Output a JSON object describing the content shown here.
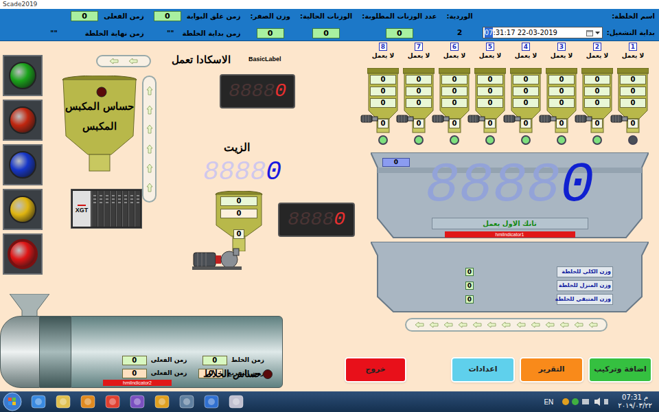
{
  "window": {
    "title": "Scade2019"
  },
  "header": {
    "recipe_label": "اسم الخلطة:",
    "start_label": "بداية التشغيل:",
    "start_time_selected": "07",
    "start_time_rest": ":31:17 22-03-2019",
    "shift_label": "الوردية:",
    "shift_value": "2",
    "required_label": "عدد الوزنات المطلوبة:",
    "required_value": "0",
    "current_label": "الوزنات الحالية:",
    "current_value": "0",
    "zero_label": "وزن الصفر:",
    "zero_value": "0",
    "gate_label": "زمن غلق البوابة",
    "gate_value": "0",
    "actual_label": "زمن الفعلى",
    "actual_value": "0",
    "mix_start_label": "زمن بداية الخلطة",
    "mix_start_value": "\"\"",
    "mix_end_label": "زمن نهاية الخلطة",
    "mix_end_value": "\"\""
  },
  "lights": [
    {
      "kind": "lamp",
      "color": "#1aa31a"
    },
    {
      "kind": "lamp",
      "color": "#c0260f"
    },
    {
      "kind": "lamp",
      "color": "#1636c8"
    },
    {
      "kind": "lamp",
      "color": "#e0b510"
    },
    {
      "kind": "button",
      "color": "#e01515"
    }
  ],
  "press": {
    "sensor_label": "حساس المكبس",
    "name": "المكبس"
  },
  "plc": {
    "label": "XGT"
  },
  "scada_status": "الاسكادا تعمل",
  "basic_label": "BasicLabel",
  "display_top": {
    "ghost": "8888",
    "value": "0"
  },
  "oil": {
    "label": "الزيت",
    "ghost": "8888",
    "value": "0",
    "tank_values": [
      "0",
      "0",
      "0"
    ],
    "display_ghost": "8888",
    "display_value": "0"
  },
  "hoppers": [
    {
      "number": "1",
      "status": "لا يعمل",
      "values": [
        "0",
        "0",
        "0",
        "0"
      ],
      "running": false
    },
    {
      "number": "2",
      "status": "لا يعمل",
      "values": [
        "0",
        "0",
        "0",
        "0"
      ],
      "running": true
    },
    {
      "number": "3",
      "status": "لا يعمل",
      "values": [
        "0",
        "0",
        "0",
        "0"
      ],
      "running": true
    },
    {
      "number": "4",
      "status": "لا يعمل",
      "values": [
        "0",
        "0",
        "0",
        "0"
      ],
      "running": true
    },
    {
      "number": "5",
      "status": "لا يعمل",
      "values": [
        "0",
        "0",
        "0",
        "0"
      ],
      "running": true
    },
    {
      "number": "6",
      "status": "لا يعمل",
      "values": [
        "0",
        "0",
        "0",
        "0"
      ],
      "running": true
    },
    {
      "number": "7",
      "status": "لا يعمل",
      "values": [
        "0",
        "0",
        "0",
        "0"
      ],
      "running": true
    },
    {
      "number": "8",
      "status": "لا يعمل",
      "values": [
        "0",
        "0",
        "0",
        "0"
      ],
      "running": true
    }
  ],
  "scale": {
    "tag": "0",
    "ghost": "8888",
    "value": "0",
    "status": "تانك الاول يعمل",
    "indicator": "hmiIndicator1"
  },
  "totals": [
    {
      "label": "وزن الكلي للخلطة",
      "value": "0"
    },
    {
      "label": "وزن المنزل للخلطة",
      "value": "0"
    },
    {
      "label": "وزن المتبقي للخلطة",
      "value": "0"
    }
  ],
  "mixer": {
    "fields": [
      {
        "label": "زمن الخلط",
        "value": "0",
        "color": "#d8f7c0"
      },
      {
        "label": "زمن الفعلى",
        "value": "0",
        "color": "#d8f7c0"
      },
      {
        "label": "زمن التفريغ",
        "value": "0",
        "color": "#fde0c0"
      },
      {
        "label": "زمن الفعلى",
        "value": "0",
        "color": "#fde0c0"
      }
    ],
    "sensor_label": "حساس الخلاط",
    "indicator": "hmiIndicator2"
  },
  "buttons": [
    {
      "label": "خروج",
      "kind": "exit",
      "color": "#e8101a"
    },
    {
      "label": "اعدادات",
      "kind": "action",
      "color": "#5fd0ec"
    },
    {
      "label": "التقرير",
      "kind": "action",
      "color": "#f98a1a"
    },
    {
      "label": "اضافة وتركيب",
      "kind": "action",
      "color": "#35c040"
    }
  ],
  "taskbar": {
    "language": "EN",
    "time": "07:31 م",
    "date": "٢٠١٩/٠٣/٢٢"
  }
}
